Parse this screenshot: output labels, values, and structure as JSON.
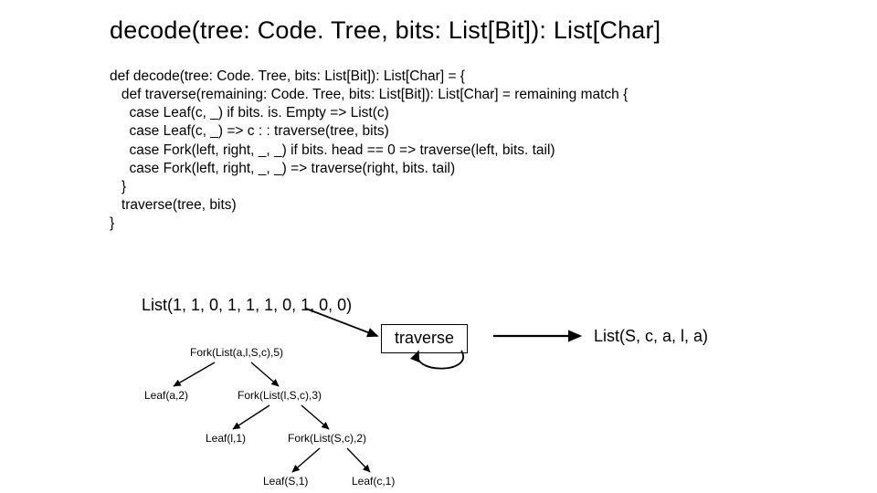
{
  "title": "decode(tree: Code. Tree, bits: List[Bit]): List[Char]",
  "code": "def decode(tree: Code. Tree, bits: List[Bit]): List[Char] = {\n   def traverse(remaining: Code. Tree, bits: List[Bit]): List[Char] = remaining match {\n     case Leaf(c, _) if bits. is. Empty => List(c)\n     case Leaf(c, _) => c : : traverse(tree, bits)\n     case Fork(left, right, _, _) if bits. head == 0 => traverse(left, bits. tail)\n     case Fork(left, right, _, _) => traverse(right, bits. tail)\n   }\n   traverse(tree, bits)\n}",
  "bit_list": "List(1, 1, 0, 1, 1, 1, 0, 1, 0, 0)",
  "traverse_label": "traverse",
  "result": "List(S, c, a, l, a)",
  "tree": {
    "n1": "Fork(List(a,l,S,c),5)",
    "n2": "Leaf(a,2)",
    "n3": "Fork(List(l,S,c),3)",
    "n4": "Leaf(l,1)",
    "n5": "Fork(List(S,c),2)",
    "n6": "Leaf(S,1)",
    "n7": "Leaf(c,1)"
  }
}
